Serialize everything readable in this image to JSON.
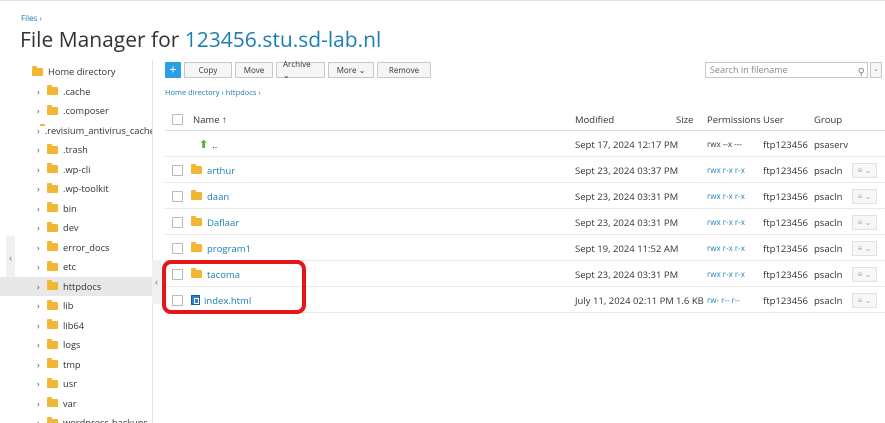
{
  "breadcrumb_top": "Files ›",
  "title": {
    "prefix": "File Manager for ",
    "host": "123456.stu.sd-lab.nl"
  },
  "sidebar": {
    "collapse_left": "‹",
    "collapse_right": "‹",
    "items": [
      {
        "label": "Home directory",
        "root": true,
        "selected": false
      },
      {
        "label": ".cache",
        "selected": false
      },
      {
        "label": ".composer",
        "selected": false
      },
      {
        "label": ".revisium_antivirus_cache",
        "selected": false
      },
      {
        "label": ".trash",
        "selected": false
      },
      {
        "label": ".wp-cli",
        "selected": false
      },
      {
        "label": ".wp-toolkit",
        "selected": false
      },
      {
        "label": "bin",
        "selected": false
      },
      {
        "label": "dev",
        "selected": false
      },
      {
        "label": "error_docs",
        "selected": false
      },
      {
        "label": "etc",
        "selected": false
      },
      {
        "label": "httpdocs",
        "selected": true
      },
      {
        "label": "lib",
        "selected": false
      },
      {
        "label": "lib64",
        "selected": false
      },
      {
        "label": "logs",
        "selected": false
      },
      {
        "label": "tmp",
        "selected": false
      },
      {
        "label": "usr",
        "selected": false
      },
      {
        "label": "var",
        "selected": false
      },
      {
        "label": "wordpress-backups",
        "selected": false
      }
    ]
  },
  "toolbar": {
    "plus": "+",
    "copy": "Copy",
    "move": "Move",
    "archive": "Archive ⌄",
    "more": "More ⌄",
    "remove": "Remove"
  },
  "search": {
    "placeholder": "Search in filename"
  },
  "path_breadcrumb": "Home directory › httpdocs ›",
  "table": {
    "headers": {
      "name": "Name ↑",
      "modified": "Modified",
      "size": "Size",
      "permissions": "Permissions",
      "user": "User",
      "group": "Group"
    },
    "rows": [
      {
        "name": "..",
        "kind": "up",
        "modified": "Sept 17, 2024 12:17 PM",
        "size": "",
        "permissions": "rwx --x ---",
        "perm_link": false,
        "user": "ftp123456",
        "group": "psaserv",
        "menu": false
      },
      {
        "name": "arthur",
        "kind": "folder",
        "modified": "Sept 23, 2024 03:37 PM",
        "size": "",
        "permissions": "rwx r-x r-x",
        "perm_link": true,
        "user": "ftp123456",
        "group": "psacln",
        "menu": true
      },
      {
        "name": "daan",
        "kind": "folder",
        "modified": "Sept 23, 2024 03:31 PM",
        "size": "",
        "permissions": "rwx r-x r-x",
        "perm_link": true,
        "user": "ftp123456",
        "group": "psacln",
        "menu": true
      },
      {
        "name": "Daflaar",
        "kind": "folder",
        "modified": "Sept 23, 2024 03:31 PM",
        "size": "",
        "permissions": "rwx r-x r-x",
        "perm_link": true,
        "user": "ftp123456",
        "group": "psacln",
        "menu": true
      },
      {
        "name": "program1",
        "kind": "folder",
        "modified": "Sept 19, 2024 11:52 AM",
        "size": "",
        "permissions": "rwx r-x r-x",
        "perm_link": true,
        "user": "ftp123456",
        "group": "psacln",
        "menu": true
      },
      {
        "name": "tacoma",
        "kind": "folder",
        "modified": "Sept 23, 2024 03:31 PM",
        "size": "",
        "permissions": "rwx r-x r-x",
        "perm_link": true,
        "user": "ftp123456",
        "group": "psacln",
        "menu": true
      },
      {
        "name": "index.html",
        "kind": "file",
        "modified": "July 11, 2024 02:11 PM",
        "size": "1.6 KB",
        "permissions": "rw- r-- r--",
        "perm_link": true,
        "user": "ftp123456",
        "group": "psacln",
        "menu": true
      }
    ],
    "menu_glyph": "≡ ⌄"
  },
  "colors": {
    "accent": "#1a7fb3",
    "folder": "#f2b635",
    "highlight": "#e5161b",
    "plus_button": "#2a9ee6"
  }
}
